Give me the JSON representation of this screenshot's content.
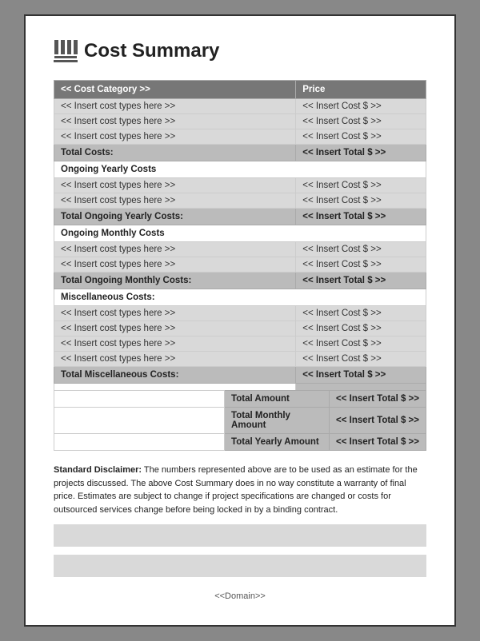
{
  "header": {
    "title": "Cost Summary"
  },
  "table": {
    "col_category": "<< Cost Category >>",
    "col_price": "Price",
    "insert_cost": "<< Insert cost types here >>",
    "insert_cost_dollar": "<< Insert Cost $ >>",
    "insert_total": "<< Insert Total $ >>",
    "sections": [
      {
        "type": "insert_group",
        "rows": [
          {
            "category": "<< Insert cost types here >>",
            "price": "<< Insert Cost $ >>"
          },
          {
            "category": "<< Insert cost types here >>",
            "price": "<< Insert Cost $ >>"
          },
          {
            "category": "<< Insert cost types here >>",
            "price": "<< Insert Cost $ >>"
          }
        ],
        "total_label": "Total Costs:",
        "total_value": "<< Insert Total $ >>"
      },
      {
        "section_label": "Ongoing Yearly Costs",
        "rows": [
          {
            "category": "<< Insert cost types here >>",
            "price": "<< Insert Cost $ >>"
          },
          {
            "category": "<< Insert cost types here >>",
            "price": "<< Insert Cost $ >>"
          }
        ],
        "total_label": "Total Ongoing Yearly Costs:",
        "total_value": "<< Insert Total $ >>"
      },
      {
        "section_label": "Ongoing Monthly Costs",
        "rows": [
          {
            "category": "<< Insert cost types here >>",
            "price": "<< Insert Cost $ >>"
          },
          {
            "category": "<< Insert cost types here >>",
            "price": "<< Insert Cost $ >>"
          }
        ],
        "total_label": "Total Ongoing Monthly Costs:",
        "total_value": "<< Insert Total $ >>"
      },
      {
        "section_label": "Miscellaneous Costs:",
        "rows": [
          {
            "category": "<< Insert cost types here >>",
            "price": "<< Insert Cost $ >>"
          },
          {
            "category": "<< Insert cost types here >>",
            "price": "<< Insert Cost $ >>"
          },
          {
            "category": "<< Insert cost types here >>",
            "price": "<< Insert Cost $ >>"
          },
          {
            "category": "<< Insert cost types here >>",
            "price": "<< Insert Cost $ >>"
          }
        ],
        "total_label": "Total Miscellaneous Costs:",
        "total_value": "<< Insert Total $ >>"
      }
    ],
    "summary": [
      {
        "label": "Total Amount",
        "value": "<< Insert Total $ >>"
      },
      {
        "label": "Total Monthly Amount",
        "value": "<< Insert Total $ >>"
      },
      {
        "label": "Total Yearly Amount",
        "value": "<< Insert Total $ >>"
      }
    ]
  },
  "disclaimer": {
    "title": "Standard Disclaimer:",
    "text": "The numbers represented above are to be used as an estimate for the projects discussed. The above Cost Summary does in no way constitute a warranty of final price. Estimates are subject to change if project specifications are changed or costs for outsourced services change before being locked in by a binding contract."
  },
  "footer": {
    "domain": "<<Domain>>"
  }
}
